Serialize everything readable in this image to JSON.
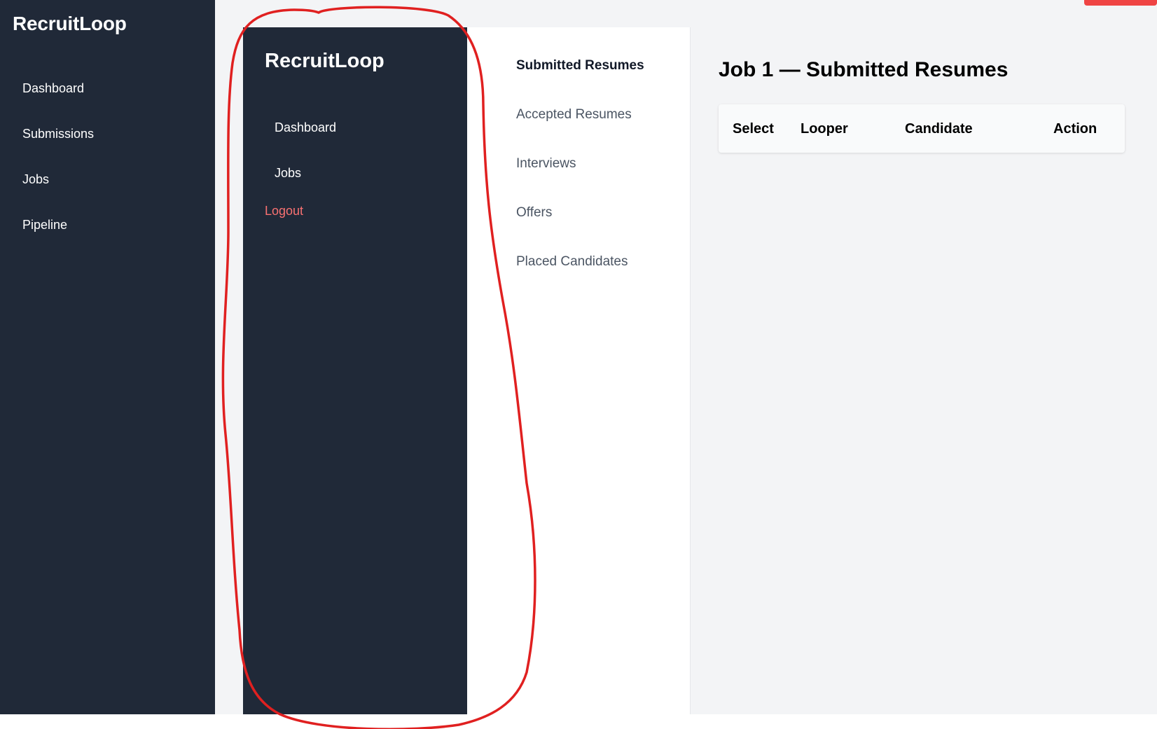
{
  "outer_sidebar": {
    "brand": "RecruitLoop",
    "items": [
      {
        "label": "Dashboard"
      },
      {
        "label": "Submissions"
      },
      {
        "label": "Jobs"
      },
      {
        "label": "Pipeline"
      }
    ]
  },
  "inner_sidebar": {
    "brand": "RecruitLoop",
    "items": [
      {
        "label": "Dashboard"
      },
      {
        "label": "Jobs"
      }
    ],
    "logout_label": "Logout"
  },
  "tabs": [
    {
      "label": "Submitted Resumes",
      "active": true
    },
    {
      "label": "Accepted Resumes",
      "active": false
    },
    {
      "label": "Interviews",
      "active": false
    },
    {
      "label": "Offers",
      "active": false
    },
    {
      "label": "Placed Candidates",
      "active": false
    }
  ],
  "main": {
    "title": "Job 1 — Submitted Resumes",
    "table": {
      "columns": [
        "Select",
        "Looper",
        "Candidate",
        "Action"
      ]
    }
  },
  "colors": {
    "sidebar_bg": "#202938",
    "page_bg": "#f3f4f6",
    "logout_text": "#f87171",
    "logout_button": "#ef4444",
    "annotation": "#e02020"
  }
}
